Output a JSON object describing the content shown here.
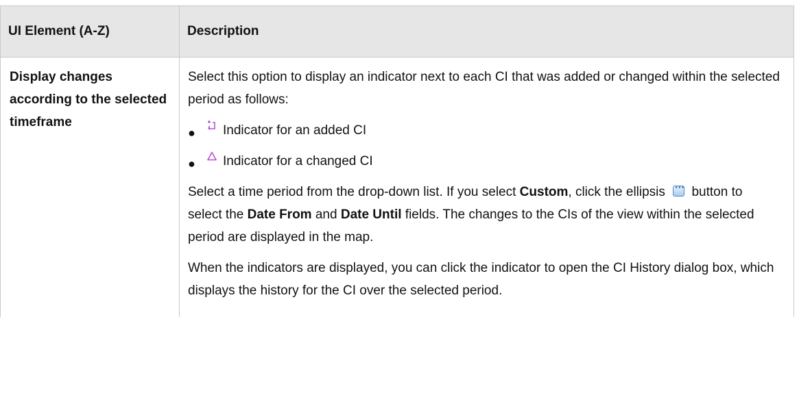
{
  "table": {
    "header": {
      "col1": "UI Element (A-Z)",
      "col2": "Description"
    },
    "row": {
      "element": "Display changes according to the selected timeframe",
      "intro": "Select this option to display an indicator next to each CI that was added or changed within the selected period as follows:",
      "bullets": [
        {
          "icon": "added-ci-indicator-icon",
          "text": "Indicator for an added CI"
        },
        {
          "icon": "changed-ci-indicator-icon",
          "text": "Indicator for a changed CI"
        }
      ],
      "para2": {
        "t1": "Select a time period from the drop-down list. If you select ",
        "b1": "Custom",
        "t2": ", click the ellipsis ",
        "t3": " button to select the ",
        "b2": "Date From",
        "t4": " and ",
        "b3": "Date Until",
        "t5": " fields. The changes to the CIs of the view within the selected period are displayed in the map."
      },
      "para3": "When the indicators are displayed, you can click the indicator to open the CI History dialog box, which displays the history for the CI over the selected period."
    }
  },
  "colors": {
    "header_bg": "#e6e6e6",
    "border": "#c8c8c8",
    "indicator_purple": "#b54fd6"
  }
}
